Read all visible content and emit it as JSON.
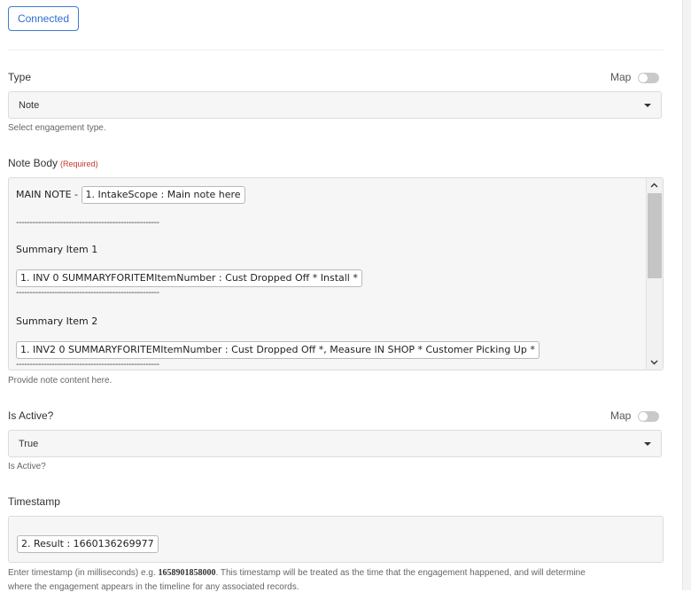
{
  "connection": {
    "button_label": "Connected"
  },
  "type_field": {
    "label": "Type",
    "map_label": "Map",
    "selected_value": "Note",
    "hint": "Select engagement type."
  },
  "note_body": {
    "label": "Note Body",
    "required_tag": "(Required)",
    "main_note_prefix": "MAIN NOTE -",
    "main_note_token": "1. IntakeScope : Main note here",
    "separator": "----------------------------------------------------",
    "summary_item_1_title": "Summary Item 1",
    "summary_item_1_token": "1. INV 0 SUMMARYFORITEMItemNumber : Cust Dropped Off * Install *",
    "summary_item_2_title": "Summary Item 2",
    "summary_item_2_token": "1. INV2 0 SUMMARYFORITEMItemNumber : Cust Dropped Off *, Measure IN SHOP * Customer Picking Up *",
    "hint": "Provide note content here."
  },
  "is_active_field": {
    "label": "Is Active?",
    "map_label": "Map",
    "selected_value": "True",
    "hint": "Is Active?"
  },
  "timestamp_field": {
    "label": "Timestamp",
    "token": "2. Result : 1660136269977",
    "hint_prefix": "Enter timestamp (in milliseconds) e.g.",
    "hint_example": "1658901858000",
    "hint_suffix": ". This timestamp will be treated as the time that the engagement happened, and will determine",
    "hint_line2": "where the engagement appears in the timeline for any associated records."
  },
  "colors": {
    "accent": "#2f6fce",
    "required": "#c0392b",
    "field_bg": "#f6f6f6",
    "toggle_off": "#c9c9c9"
  }
}
